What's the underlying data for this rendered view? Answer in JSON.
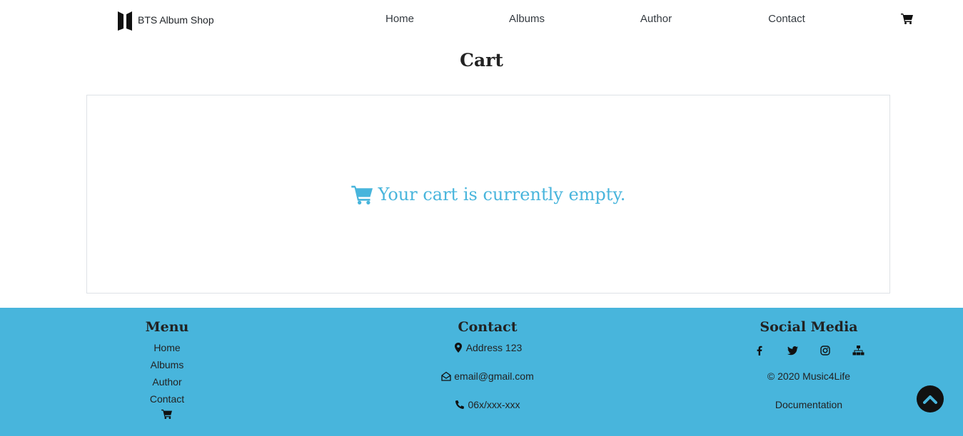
{
  "nav": {
    "brand": "BTS Album Shop",
    "links": [
      "Home",
      "Albums",
      "Author",
      "Contact"
    ],
    "cart_icon": "shopping-cart-icon"
  },
  "page": {
    "title": "Cart",
    "empty_message": "Your cart is currently empty.",
    "empty_icon": "shopping-cart-icon"
  },
  "footer": {
    "menu": {
      "heading": "Menu",
      "items": [
        "Home",
        "Albums",
        "Author",
        "Contact"
      ],
      "cart_icon": "shopping-cart-icon"
    },
    "contact": {
      "heading": "Contact",
      "address": "Address 123",
      "email": "email@gmail.com",
      "phone": "06x/xxx-xxx"
    },
    "social": {
      "heading": "Social Media",
      "icons": [
        "facebook-icon",
        "twitter-icon",
        "instagram-icon",
        "sitemap-icon"
      ],
      "copyright": "© 2020 Music4Life",
      "documentation": "Documentation"
    }
  },
  "colors": {
    "accent": "#48b5dc",
    "footer_bg": "#48b5dc",
    "text": "#222222",
    "scroll_button": "#111111"
  }
}
